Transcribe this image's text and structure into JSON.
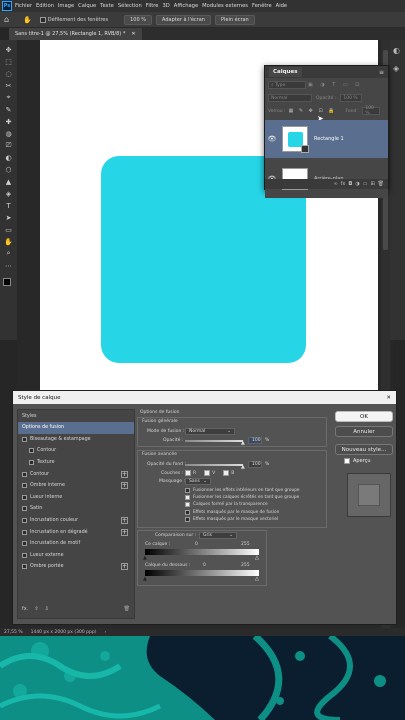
{
  "app": {
    "logo": "Ps"
  },
  "menu": [
    "Fichier",
    "Edition",
    "Image",
    "Calque",
    "Texte",
    "Sélection",
    "Filtre",
    "3D",
    "Affichage",
    "Modules externes",
    "Fenêtre",
    "Aide"
  ],
  "options_bar": {
    "scroll_all": "Défilement des fenêtres",
    "zoom": "100 %",
    "fit": "Adapter à l'écran",
    "fill": "Plein écran"
  },
  "document": {
    "tab_title": "Sans titre-1 @ 27,5% (Rectangle 1, RVB/8) *"
  },
  "colors": {
    "shape": "#26d5e6",
    "accent": "#31a8ff",
    "decor_dark": "#0b1e30",
    "decor_teal": "#0e8f85"
  },
  "layers_panel": {
    "title": "Calques",
    "kind": "Type",
    "blend": "Normal",
    "opacity_label": "Opacité :",
    "opacity": "100 %",
    "lock_label": "Verrou :",
    "fill_label": "Fond :",
    "fill": "100 %",
    "layers": [
      {
        "name": "Rectangle 1"
      },
      {
        "name": "Arrière-plan"
      }
    ]
  },
  "dialog": {
    "title": "Style de calque",
    "close": "✕",
    "list_header": "Styles",
    "items": [
      {
        "label": "Options de fusion",
        "check": false,
        "plus": false,
        "indent": false,
        "sel": true
      },
      {
        "label": "Biseautage & estampage",
        "check": true,
        "plus": false,
        "indent": false,
        "sel": false
      },
      {
        "label": "Contour",
        "check": true,
        "plus": false,
        "indent": true,
        "sel": false
      },
      {
        "label": "Texture",
        "check": true,
        "plus": false,
        "indent": true,
        "sel": false
      },
      {
        "label": "Contour",
        "check": true,
        "plus": true,
        "indent": false,
        "sel": false
      },
      {
        "label": "Ombre interne",
        "check": true,
        "plus": true,
        "indent": false,
        "sel": false
      },
      {
        "label": "Lueur interne",
        "check": true,
        "plus": false,
        "indent": false,
        "sel": false
      },
      {
        "label": "Satin",
        "check": true,
        "plus": false,
        "indent": false,
        "sel": false
      },
      {
        "label": "Incrustation couleur",
        "check": true,
        "plus": true,
        "indent": false,
        "sel": false
      },
      {
        "label": "Incrustation en dégradé",
        "check": true,
        "plus": true,
        "indent": false,
        "sel": false
      },
      {
        "label": "Incrustation de motif",
        "check": true,
        "plus": false,
        "indent": false,
        "sel": false
      },
      {
        "label": "Lueur externe",
        "check": true,
        "plus": false,
        "indent": false,
        "sel": false
      },
      {
        "label": "Ombre portée",
        "check": true,
        "plus": true,
        "indent": false,
        "sel": false
      }
    ],
    "fx_label": "fx.",
    "blend_options": "Options de fusion",
    "general": "Fusion générale",
    "mode_label": "Mode de fusion :",
    "mode": "Normal",
    "opacity_label": "Opacité :",
    "opacity": "100",
    "pct": "%",
    "advanced": "Fusion avancée",
    "fill_opacity_label": "Opacité du fond :",
    "fill_opacity": "100",
    "channels_label": "Couches :",
    "channels": [
      "R",
      "V",
      "B"
    ],
    "knockout_label": "Masquage :",
    "knockout": "Sans",
    "options": [
      {
        "label": "Fusionner les effets intérieurs en tant que groupe",
        "on": false
      },
      {
        "label": "Fusionner les calques écrêtés en tant que groupe",
        "on": true
      },
      {
        "label": "Calques formé par la transparence",
        "on": true
      },
      {
        "label": "Effets masqués par le masque de fusion",
        "on": false
      },
      {
        "label": "Effets masqués par le masque vectoriel",
        "on": false
      }
    ],
    "blendif_label": "Comparaison sur :",
    "blendif": "Gris",
    "this_layer": "Ce calque :",
    "this_vals": [
      "0",
      "255"
    ],
    "under_layer": "Calque du dessous :",
    "under_vals": [
      "0",
      "255"
    ],
    "ok": "OK",
    "cancel": "Annuler",
    "new_style": "Nouveau style...",
    "preview": "Aperçu"
  },
  "status": {
    "zoom": "27,55 %",
    "info": "1440 px x 2000 px (300 ppp)"
  }
}
